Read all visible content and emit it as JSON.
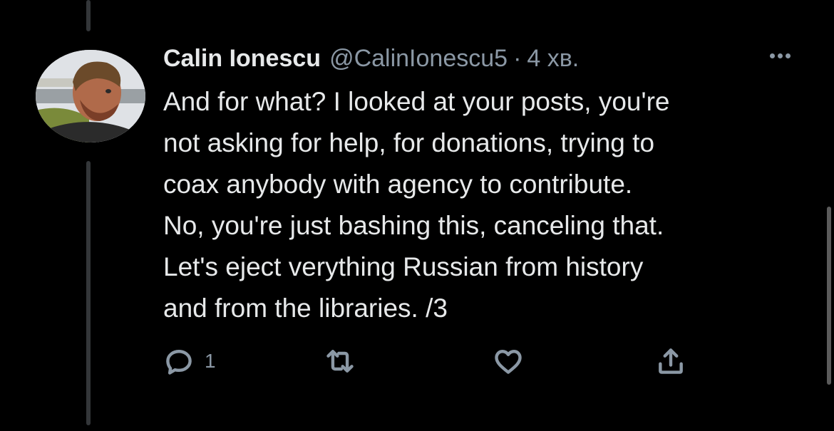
{
  "tweet": {
    "author_name": "Calin Ionescu",
    "handle": "@CalinIonescu5",
    "separator": "·",
    "time": "4 хв.",
    "text_lines": [
      "And for what? I looked at your posts, you're",
      "not asking for help, for donations, trying to",
      "coax anybody with agency to contribute.",
      "No, you're just bashing this, canceling that.",
      "Let's eject verything Russian from history",
      "and from the libraries.  /3"
    ]
  },
  "actions": {
    "reply_icon": "reply-bubble-icon",
    "reply_count": "1",
    "retweet_icon": "retweet-icon",
    "like_icon": "heart-icon",
    "share_icon": "share-upload-icon"
  },
  "colors": {
    "background": "#000000",
    "text": "#e7e9ea",
    "secondary": "#8b98a5",
    "thread_line": "#333639"
  }
}
